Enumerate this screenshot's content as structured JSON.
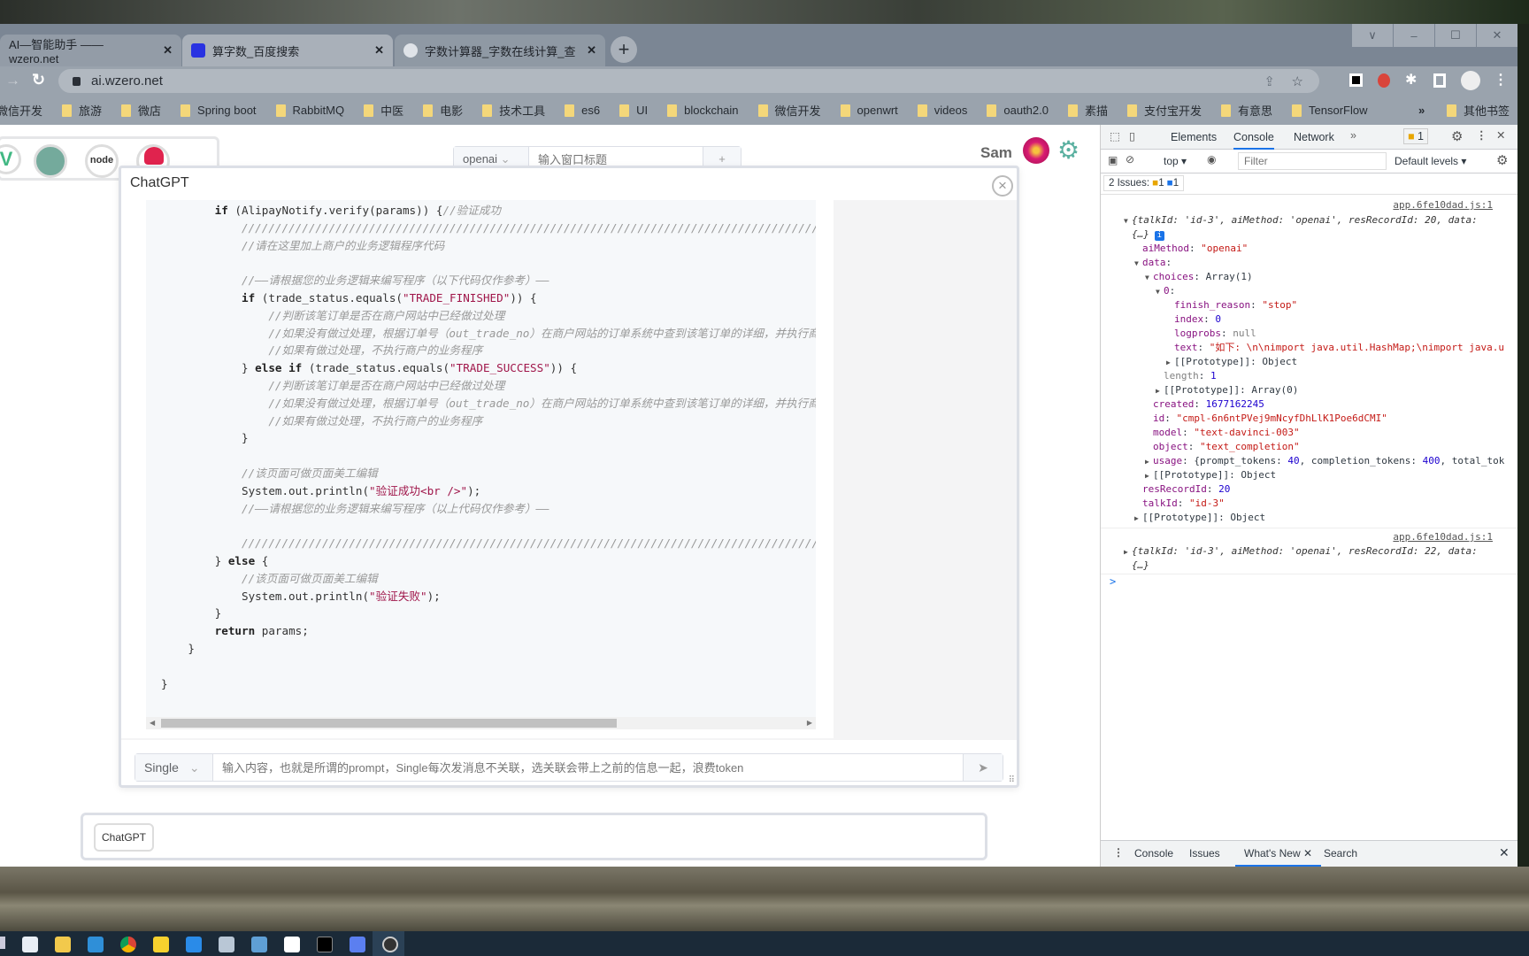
{
  "browser": {
    "tabs": [
      {
        "title": "AI—智能助手 —— wzero.net",
        "active": true
      },
      {
        "title": "算字数_百度搜索",
        "active": false
      },
      {
        "title": "字数计算器_字数在线计算_查字数",
        "active": false
      }
    ],
    "new_tab": "+",
    "window_controls": [
      "∨",
      "–",
      "☐",
      "✕"
    ],
    "url": "ai.wzero.net",
    "bookmarks": [
      "微信开发",
      "旅游",
      "微店",
      "Spring boot",
      "RabbitMQ",
      "中医",
      "电影",
      "技术工具",
      "es6",
      "UI",
      "blockchain",
      "微信开发",
      "openwrt",
      "videos",
      "oauth2.0",
      "素描",
      "支付宝开发",
      "有意思",
      "TensorFlow"
    ],
    "bookmarks_more": "»",
    "other_bookmarks": "其他书签"
  },
  "app": {
    "method_select": "openai",
    "title_placeholder": "输入窗口标题",
    "add_label": "+",
    "username": "Sam",
    "modal": {
      "title": "ChatGPT",
      "close": "×",
      "mode_select": "Single",
      "prompt_placeholder": "输入内容，也就是所谓的prompt，Single每次发消息不关联，选关联会带上之前的信息一起，浪费token"
    },
    "dock_button": "ChatGPT",
    "code": [
      [
        [
          "pl",
          "        "
        ],
        [
          "kw",
          "if"
        ],
        [
          "pl",
          " (AlipayNotify.verify(params)) {"
        ],
        [
          "cm",
          "//验证成功"
        ]
      ],
      [
        [
          "pl",
          "            "
        ],
        [
          "cm",
          "//////////////////////////////////////////////////////////////////////////////////////////"
        ]
      ],
      [
        [
          "pl",
          "            "
        ],
        [
          "cm",
          "//请在这里加上商户的业务逻辑程序代码"
        ]
      ],
      [],
      [
        [
          "pl",
          "            "
        ],
        [
          "cm",
          "//——请根据您的业务逻辑来编写程序（以下代码仅作参考）——"
        ]
      ],
      [
        [
          "pl",
          "            "
        ],
        [
          "kw",
          "if"
        ],
        [
          "pl",
          " (trade_status.equals("
        ],
        [
          "st",
          "\"TRADE_FINISHED\""
        ],
        [
          "pl",
          ")) {"
        ]
      ],
      [
        [
          "pl",
          "                "
        ],
        [
          "cm",
          "//判断该笔订单是否在商户网站中已经做过处理"
        ]
      ],
      [
        [
          "pl",
          "                "
        ],
        [
          "cm",
          "//如果没有做过处理，根据订单号（out_trade_no）在商户网站的订单系统中查到该笔订单的详细，并执行商户的业务程序"
        ]
      ],
      [
        [
          "pl",
          "                "
        ],
        [
          "cm",
          "//如果有做过处理，不执行商户的业务程序"
        ]
      ],
      [
        [
          "pl",
          "            } "
        ],
        [
          "kw",
          "else if"
        ],
        [
          "pl",
          " (trade_status.equals("
        ],
        [
          "st",
          "\"TRADE_SUCCESS\""
        ],
        [
          "pl",
          ")) {"
        ]
      ],
      [
        [
          "pl",
          "                "
        ],
        [
          "cm",
          "//判断该笔订单是否在商户网站中已经做过处理"
        ]
      ],
      [
        [
          "pl",
          "                "
        ],
        [
          "cm",
          "//如果没有做过处理，根据订单号（out_trade_no）在商户网站的订单系统中查到该笔订单的详细，并执行商户的业务程序"
        ]
      ],
      [
        [
          "pl",
          "                "
        ],
        [
          "cm",
          "//如果有做过处理，不执行商户的业务程序"
        ]
      ],
      [
        [
          "pl",
          "            }"
        ]
      ],
      [],
      [
        [
          "pl",
          "            "
        ],
        [
          "cm",
          "//该页面可做页面美工编辑"
        ]
      ],
      [
        [
          "pl",
          "            System.out.println("
        ],
        [
          "st",
          "\"验证成功<br />\""
        ],
        [
          "pl",
          ");"
        ]
      ],
      [
        [
          "pl",
          "            "
        ],
        [
          "cm",
          "//——请根据您的业务逻辑来编写程序（以上代码仅作参考）——"
        ]
      ],
      [],
      [
        [
          "pl",
          "            "
        ],
        [
          "cm",
          "//////////////////////////////////////////////////////////////////////////////////////////"
        ]
      ],
      [
        [
          "pl",
          "        } "
        ],
        [
          "kw",
          "else"
        ],
        [
          "pl",
          " {"
        ]
      ],
      [
        [
          "pl",
          "            "
        ],
        [
          "cm",
          "//该页面可做页面美工编辑"
        ]
      ],
      [
        [
          "pl",
          "            System.out.println("
        ],
        [
          "st",
          "\"验证失败\""
        ],
        [
          "pl",
          ");"
        ]
      ],
      [
        [
          "pl",
          "        }"
        ]
      ],
      [
        [
          "pl",
          "        "
        ],
        [
          "kw",
          "return"
        ],
        [
          "pl",
          " params;"
        ]
      ],
      [
        [
          "pl",
          "    }"
        ]
      ],
      [],
      [
        [
          "pl",
          "}"
        ]
      ]
    ]
  },
  "devtools": {
    "tabs": [
      "Elements",
      "Console",
      "Network"
    ],
    "active_tab": "Console",
    "more_tabs": "»",
    "issue_badge": "1",
    "context": "top ▾",
    "filter_placeholder": "Filter",
    "levels": "Default levels ▾",
    "issues_summary": "2 Issues:",
    "issues_warn": "1",
    "issues_info": "1",
    "source_link": "app.6fe10dad.js:1",
    "console_rows": [
      {
        "lvl": 0,
        "exp": "open",
        "segs": [
          [
            "it",
            "{talkId: 'id-3', aiMethod: 'openai', resRecordId: 20, data:"
          ]
        ]
      },
      {
        "lvl": 0,
        "exp": "",
        "segs": [
          [
            "it",
            "{…}"
          ]
        ],
        "info": true
      },
      {
        "lvl": 1,
        "exp": "",
        "segs": [
          [
            "k",
            "aiMethod"
          ],
          [
            "",
            ": "
          ],
          [
            "s",
            "\"openai\""
          ]
        ]
      },
      {
        "lvl": 1,
        "exp": "open",
        "segs": [
          [
            "k",
            "data"
          ],
          [
            "",
            ":"
          ]
        ]
      },
      {
        "lvl": 2,
        "exp": "open",
        "segs": [
          [
            "k",
            "choices"
          ],
          [
            "",
            ": Array(1)"
          ]
        ]
      },
      {
        "lvl": 3,
        "exp": "open",
        "segs": [
          [
            "k",
            "0"
          ],
          [
            "",
            ":"
          ]
        ]
      },
      {
        "lvl": 4,
        "exp": "",
        "segs": [
          [
            "k",
            "finish_reason"
          ],
          [
            "",
            ": "
          ],
          [
            "s",
            "\"stop\""
          ]
        ]
      },
      {
        "lvl": 4,
        "exp": "",
        "segs": [
          [
            "k",
            "index"
          ],
          [
            "",
            ": "
          ],
          [
            "n",
            "0"
          ]
        ]
      },
      {
        "lvl": 4,
        "exp": "",
        "segs": [
          [
            "k",
            "logprobs"
          ],
          [
            "",
            ": "
          ],
          [
            "nl",
            "null"
          ]
        ]
      },
      {
        "lvl": 4,
        "exp": "",
        "segs": [
          [
            "k",
            "text"
          ],
          [
            "",
            ": "
          ],
          [
            "s",
            "\"如下: \\n\\nimport java.util.HashMap;\\nimport java.u"
          ]
        ]
      },
      {
        "lvl": 4,
        "exp": "closed",
        "segs": [
          [
            "",
            "[[Prototype]]: Object"
          ]
        ]
      },
      {
        "lvl": 3,
        "exp": "",
        "segs": [
          [
            "nl",
            "length"
          ],
          [
            "",
            ": "
          ],
          [
            "n",
            "1"
          ]
        ]
      },
      {
        "lvl": 3,
        "exp": "closed",
        "segs": [
          [
            "",
            "[[Prototype]]: Array(0)"
          ]
        ]
      },
      {
        "lvl": 2,
        "exp": "",
        "segs": [
          [
            "k",
            "created"
          ],
          [
            "",
            ": "
          ],
          [
            "n",
            "1677162245"
          ]
        ]
      },
      {
        "lvl": 2,
        "exp": "",
        "segs": [
          [
            "k",
            "id"
          ],
          [
            "",
            ": "
          ],
          [
            "s",
            "\"cmpl-6n6ntPVej9mNcyfDhLlK1Poe6dCMI\""
          ]
        ]
      },
      {
        "lvl": 2,
        "exp": "",
        "segs": [
          [
            "k",
            "model"
          ],
          [
            "",
            ": "
          ],
          [
            "s",
            "\"text-davinci-003\""
          ]
        ]
      },
      {
        "lvl": 2,
        "exp": "",
        "segs": [
          [
            "k",
            "object"
          ],
          [
            "",
            ": "
          ],
          [
            "s",
            "\"text_completion\""
          ]
        ]
      },
      {
        "lvl": 2,
        "exp": "closed",
        "segs": [
          [
            "k",
            "usage"
          ],
          [
            "",
            ": {prompt_tokens: "
          ],
          [
            "n",
            "40"
          ],
          [
            "",
            ", completion_tokens: "
          ],
          [
            "n",
            "400"
          ],
          [
            "",
            ", total_tok"
          ]
        ]
      },
      {
        "lvl": 2,
        "exp": "closed",
        "segs": [
          [
            "",
            "[[Prototype]]: Object"
          ]
        ]
      },
      {
        "lvl": 1,
        "exp": "",
        "segs": [
          [
            "k",
            "resRecordId"
          ],
          [
            "",
            ": "
          ],
          [
            "n",
            "20"
          ]
        ]
      },
      {
        "lvl": 1,
        "exp": "",
        "segs": [
          [
            "k",
            "talkId"
          ],
          [
            "",
            ": "
          ],
          [
            "s",
            "\"id-3\""
          ]
        ]
      },
      {
        "lvl": 1,
        "exp": "closed",
        "segs": [
          [
            "",
            "[[Prototype]]: Object"
          ]
        ]
      }
    ],
    "second_message": [
      "{talkId: 'id-3', aiMethod: 'openai', resRecordId: 22, data:",
      "{…}"
    ],
    "prompt": ">",
    "drawer_tabs": [
      "Console",
      "Issues",
      "What's New",
      "Search"
    ],
    "drawer_active": "What's New"
  },
  "colors": {
    "accent": "#1a73e8",
    "modal_border": "#dcdfe6",
    "code_bg": "#f6f8fa"
  }
}
